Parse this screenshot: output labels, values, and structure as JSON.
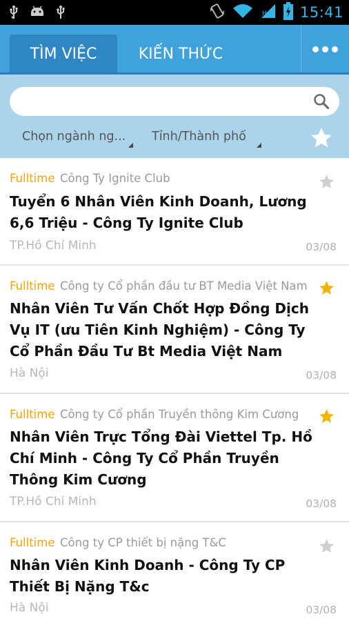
{
  "status_bar": {
    "time": "15:41",
    "left_icons": [
      "usb-icon",
      "android-debug-icon",
      "usb-icon"
    ],
    "right_icons": [
      "vibrate-icon",
      "wifi-icon",
      "signal-icon",
      "battery-charging-icon"
    ]
  },
  "tabs": [
    {
      "label": "TÌM VIỆC",
      "active": true
    },
    {
      "label": "KIẾN THỨC",
      "active": false
    }
  ],
  "overflow_menu_icon": "more-dots-icon",
  "search": {
    "value": "",
    "placeholder": ""
  },
  "filters": {
    "industry": "Chọn ngành ng...",
    "province": "Tỉnh/Thành phố"
  },
  "colors": {
    "tabbar": "#3fa2dd",
    "tab_active": "#2e86c4",
    "filter_bg": "#abd3e9",
    "job_type": "#f4a300",
    "star_active": "#f2b400",
    "star_inactive": "#cfcfcf"
  },
  "jobs": [
    {
      "type": "Fulltime",
      "company": "Công Ty Ignite Club",
      "title": "Tuyển 6 Nhân Viên Kinh Doanh, Lương 6,6 Triệu - Công Ty Ignite Club",
      "location": "TP.Hồ Chí Minh",
      "date": "03/08",
      "starred": false
    },
    {
      "type": "Fulltime",
      "company": "Công ty Cổ phần đầu tư BT Media Việt Nam",
      "title": "Nhân Viên Tư Vấn Chốt Hợp Đồng Dịch Vụ IT (ưu Tiên Kinh Nghiệm) - Công Ty Cổ Phần Đầu Tư Bt Media Việt Nam",
      "location": "Hà Nội",
      "date": "03/08",
      "starred": true
    },
    {
      "type": "Fulltime",
      "company": "Công ty Cổ phần Truyền thông Kim Cương",
      "title": "Nhân Viên Trực Tổng Đài Viettel Tp. Hồ Chí Minh - Công Ty Cổ Phần Truyền Thông Kim Cương",
      "location": "TP.Hồ Chí Minh",
      "date": "03/08",
      "starred": true
    },
    {
      "type": "Fulltime",
      "company": "Công ty CP thiết bị nặng T&C",
      "title": "Nhân Viên Kinh Doanh - Công Ty CP Thiết Bị Nặng T&c",
      "location": "Hà Nội",
      "date": "03/08",
      "starred": false
    }
  ]
}
